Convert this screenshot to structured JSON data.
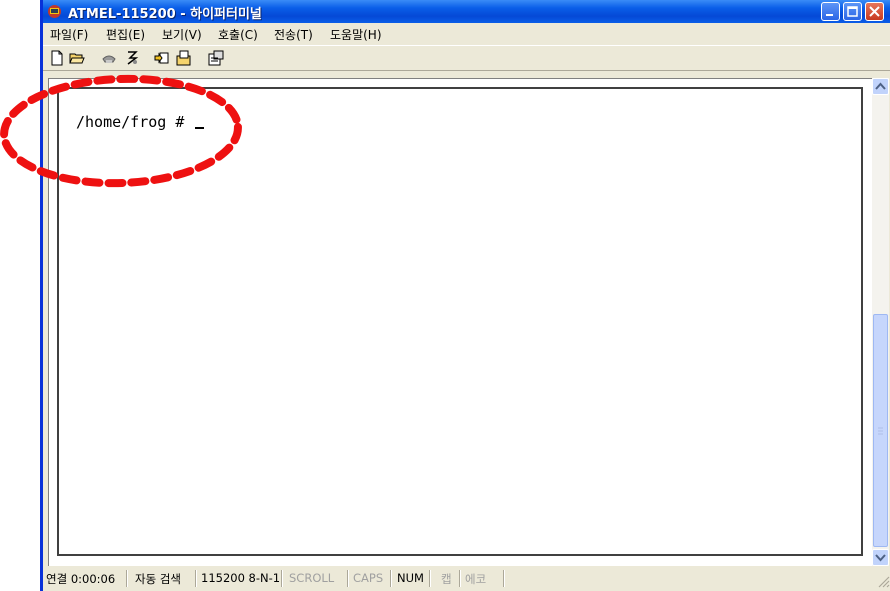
{
  "window": {
    "title": "ATMEL-115200 - 하이퍼터미널",
    "icon": "hyperterminal-app-icon",
    "caption_buttons": [
      "minimize",
      "maximize",
      "close"
    ]
  },
  "menu": [
    "파일(F)",
    "편집(E)",
    "보기(V)",
    "호출(C)",
    "전송(T)",
    "도움말(H)"
  ],
  "toolbar": {
    "buttons": [
      "new-document-icon",
      "open-folder-icon",
      "connect-phone-icon",
      "disconnect-icon",
      "send-icon",
      "receive-icon",
      "properties-icon"
    ]
  },
  "terminal": {
    "prompt": "/home/frog # "
  },
  "status_bar": {
    "connected": "연결 0:00:06",
    "detect": "자동 검색",
    "port_settings": "115200 8-N-1",
    "scroll": "SCROLL",
    "caps": "CAPS",
    "num": "NUM",
    "capture": "캡",
    "echo": "에코"
  },
  "colors": {
    "annotation": "#ee1111",
    "titlebar": "#0a5ee8"
  }
}
